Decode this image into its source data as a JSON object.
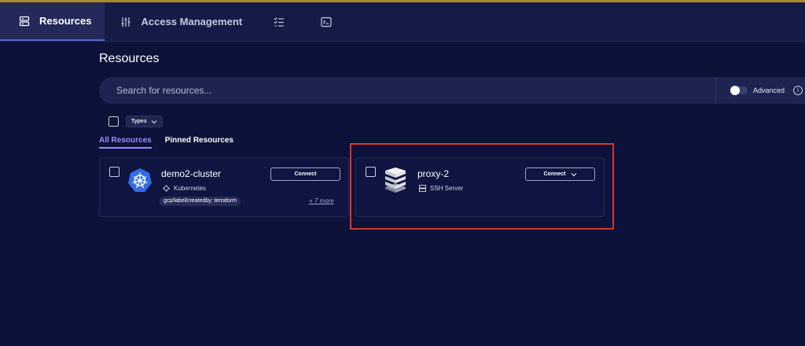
{
  "nav": {
    "tabs": [
      {
        "label": "Resources",
        "icon": "server-stack-icon",
        "active": true
      },
      {
        "label": "Access Management",
        "icon": "sliders-icon",
        "active": false
      },
      {
        "label": "",
        "icon": "checklist-icon",
        "active": false
      },
      {
        "label": "",
        "icon": "terminal-icon",
        "active": false
      }
    ]
  },
  "page": {
    "title": "Resources"
  },
  "search": {
    "placeholder": "Search for resources...",
    "value": "",
    "advanced_label": "Advanced",
    "advanced_enabled": false
  },
  "filters": {
    "types_label": "Types"
  },
  "resource_tabs": [
    {
      "label": "All Resources",
      "active": true
    },
    {
      "label": "Pinned Resources",
      "active": false
    }
  ],
  "resources": [
    {
      "name": "demo2-cluster",
      "type": "Kubernetes",
      "type_icon": "kubernetes-wheel-icon",
      "connect_label": "Connect",
      "label": "gcp/label/createdby: terraform",
      "more": "+ 7 more"
    },
    {
      "name": "proxy-2",
      "type": "SSH Server",
      "type_icon": "server-icon",
      "connect_label": "Connect"
    }
  ],
  "colors": {
    "background": "#0c1239",
    "topbar": "#151b46",
    "accent": "#9e8cff",
    "highlight": "#d8362b",
    "kubernetes": "#326ce5"
  }
}
